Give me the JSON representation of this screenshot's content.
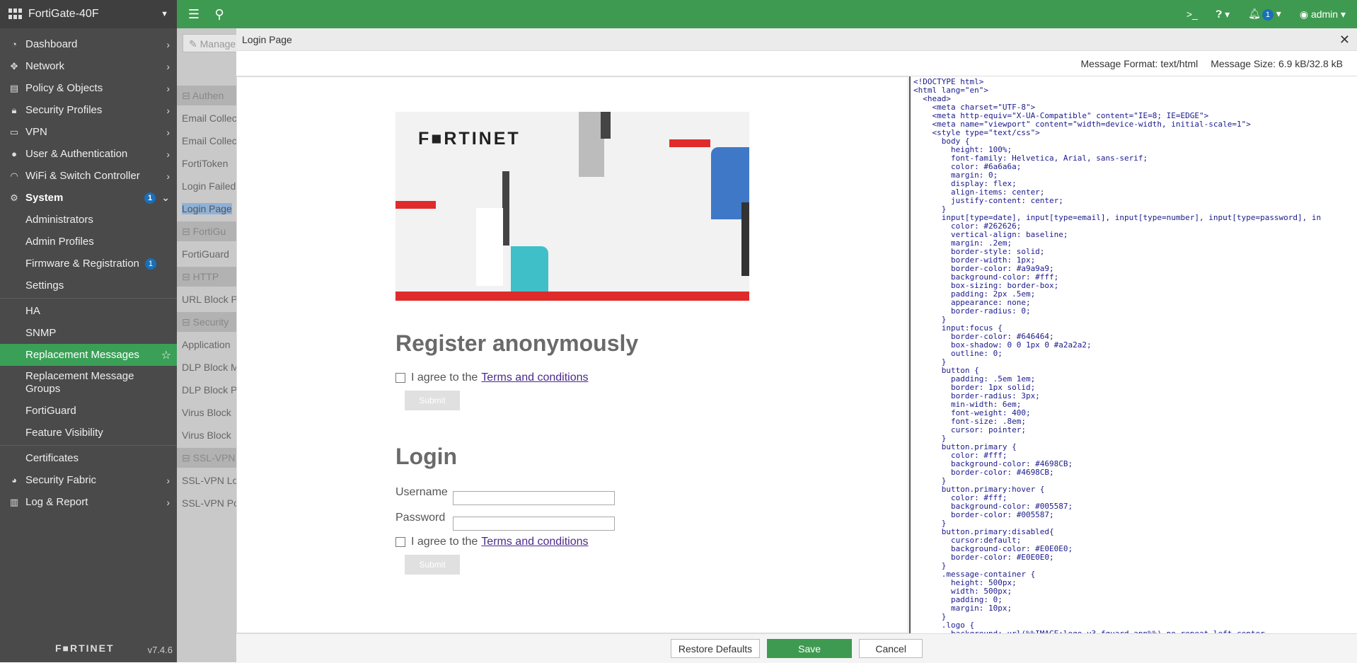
{
  "sidebar": {
    "device": "FortiGate-40F",
    "items": [
      {
        "label": "Dashboard",
        "icon": "dashboard-icon"
      },
      {
        "label": "Network",
        "icon": "network-icon"
      },
      {
        "label": "Policy & Objects",
        "icon": "policy-icon"
      },
      {
        "label": "Security Profiles",
        "icon": "lock-icon"
      },
      {
        "label": "VPN",
        "icon": "monitor-icon"
      },
      {
        "label": "User & Authentication",
        "icon": "user-icon"
      },
      {
        "label": "WiFi & Switch Controller",
        "icon": "wifi-icon"
      },
      {
        "label": "System",
        "icon": "gear-icon",
        "badge": "1"
      },
      {
        "label": "Administrators"
      },
      {
        "label": "Admin Profiles"
      },
      {
        "label": "Firmware & Registration",
        "badge": "1"
      },
      {
        "label": "Settings"
      },
      {
        "label": "HA"
      },
      {
        "label": "SNMP"
      },
      {
        "label": "Replacement Messages"
      },
      {
        "label": "Replacement Message Groups"
      },
      {
        "label": "FortiGuard"
      },
      {
        "label": "Feature Visibility"
      },
      {
        "label": "Certificates"
      },
      {
        "label": "Security Fabric",
        "icon": "fabric-icon"
      },
      {
        "label": "Log & Report",
        "icon": "chart-icon"
      }
    ],
    "logo": "F■RTINET",
    "version": "v7.4.6"
  },
  "topbar": {
    "notifications_count": "1",
    "user": "admin"
  },
  "background_page": {
    "manage_button": "Manage",
    "rows": [
      "Authen",
      "Email Collec",
      "Email Collec",
      "FortiToken",
      "Login Failed",
      "Login Page",
      "FortiGu",
      "FortiGuard",
      "HTTP",
      "URL Block P",
      "Security",
      "Application",
      "DLP Block M",
      "DLP Block P",
      "Virus Block",
      "Virus Block",
      "SSL-VPN",
      "SSL-VPN Lo",
      "SSL-VPN Po"
    ]
  },
  "dialog": {
    "title": "Login Page",
    "message_format": "Message Format: text/html",
    "message_size": "Message Size: 6.9 kB/32.8 kB",
    "preview": {
      "logo": "F■RTINET",
      "register_heading": "Register anonymously",
      "agree_text": "I agree to the",
      "terms_link": "Terms and conditions",
      "submit": "Submit",
      "login_heading": "Login",
      "username_label": "Username",
      "password_label": "Password"
    },
    "buttons": {
      "restore": "Restore Defaults",
      "save": "Save",
      "cancel": "Cancel"
    },
    "code_lines": [
      "<!DOCTYPE html>",
      "<html lang=\"en\">",
      "  <head>",
      "    <meta charset=\"UTF-8\">",
      "    <meta http-equiv=\"X-UA-Compatible\" content=\"IE=8; IE=EDGE\">",
      "    <meta name=\"viewport\" content=\"width=device-width, initial-scale=1\">",
      "    <style type=\"text/css\">",
      "      body {",
      "        height: 100%;",
      "        font-family: Helvetica, Arial, sans-serif;",
      "        color: #6a6a6a;",
      "        margin: 0;",
      "        display: flex;",
      "        align-items: center;",
      "        justify-content: center;",
      "      }",
      "      input[type=date], input[type=email], input[type=number], input[type=password], in",
      "        color: #262626;",
      "        vertical-align: baseline;",
      "        margin: .2em;",
      "        border-style: solid;",
      "        border-width: 1px;",
      "        border-color: #a9a9a9;",
      "        background-color: #fff;",
      "        box-sizing: border-box;",
      "        padding: 2px .5em;",
      "        appearance: none;",
      "        border-radius: 0;",
      "      }",
      "      input:focus {",
      "        border-color: #646464;",
      "        box-shadow: 0 0 1px 0 #a2a2a2;",
      "        outline: 0;",
      "      }",
      "      button {",
      "        padding: .5em 1em;",
      "        border: 1px solid;",
      "        border-radius: 3px;",
      "        min-width: 6em;",
      "        font-weight: 400;",
      "        font-size: .8em;",
      "        cursor: pointer;",
      "      }",
      "      button.primary {",
      "        color: #fff;",
      "        background-color: #4698CB;",
      "        border-color: #4698CB;",
      "      }",
      "      button.primary:hover {",
      "        color: #fff;",
      "        background-color: #005587;",
      "        border-color: #005587;",
      "      }",
      "      button.primary:disabled{",
      "        cursor:default;",
      "        background-color: #E0E0E0;",
      "        border-color: #E0E0E0;",
      "      }",
      "      .message-container {",
      "        height: 500px;",
      "        width: 500px;",
      "        padding: 0;",
      "        margin: 10px;",
      "      }",
      "      .logo {",
      "        background: url(%%IMAGE:logo_v3_fguard_app%%) no-repeat left center"
    ]
  }
}
